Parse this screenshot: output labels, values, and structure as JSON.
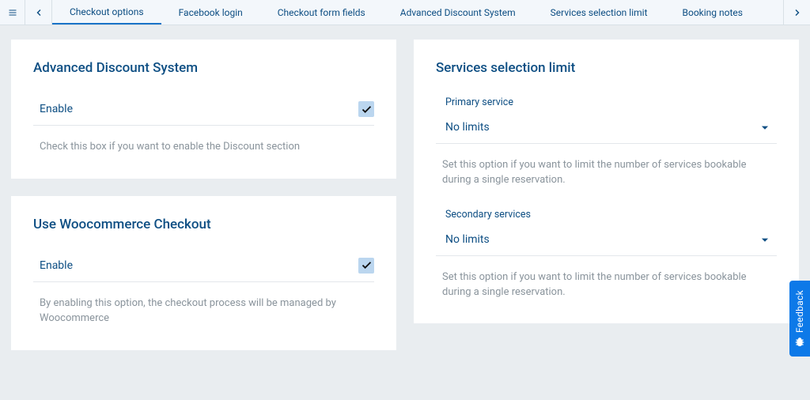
{
  "tabs": {
    "items": [
      {
        "label": "Checkout options"
      },
      {
        "label": "Facebook login"
      },
      {
        "label": "Checkout form fields"
      },
      {
        "label": "Advanced Discount System"
      },
      {
        "label": "Services selection limit"
      },
      {
        "label": "Booking notes"
      }
    ]
  },
  "card_ads": {
    "title": "Advanced Discount System",
    "enable_label": "Enable",
    "enable_checked": true,
    "help": "Check this box if you want to enable the Discount section"
  },
  "card_woo": {
    "title": "Use Woocommerce Checkout",
    "enable_label": "Enable",
    "enable_checked": true,
    "help": "By enabling this option, the checkout process will be managed by Woocommerce"
  },
  "card_ssl": {
    "title": "Services selection limit",
    "primary_label": "Primary service",
    "primary_value": "No limits",
    "primary_help": "Set this option if you want to limit the number of services bookable during a single reservation.",
    "secondary_label": "Secondary services",
    "secondary_value": "No limits",
    "secondary_help": "Set this option if you want to limit the number of services bookable during a single reservation."
  },
  "feedback": {
    "label": "Feedback"
  }
}
